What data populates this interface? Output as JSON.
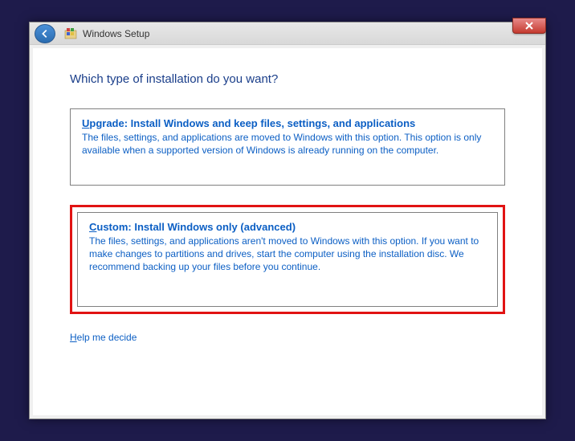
{
  "window": {
    "title": "Windows Setup"
  },
  "heading": "Which type of installation do you want?",
  "options": {
    "upgrade": {
      "title_prefix": "U",
      "title_rest": "pgrade: Install Windows and keep files, settings, and applications",
      "description": "The files, settings, and applications are moved to Windows with this option. This option is only available when a supported version of Windows is already running on the computer."
    },
    "custom": {
      "title_prefix": "C",
      "title_rest": "ustom: Install Windows only (advanced)",
      "description": "The files, settings, and applications aren't moved to Windows with this option. If you want to make changes to partitions and drives, start the computer using the installation disc. We recommend backing up your files before you continue."
    }
  },
  "help_link": {
    "prefix": "H",
    "rest": "elp me decide"
  }
}
